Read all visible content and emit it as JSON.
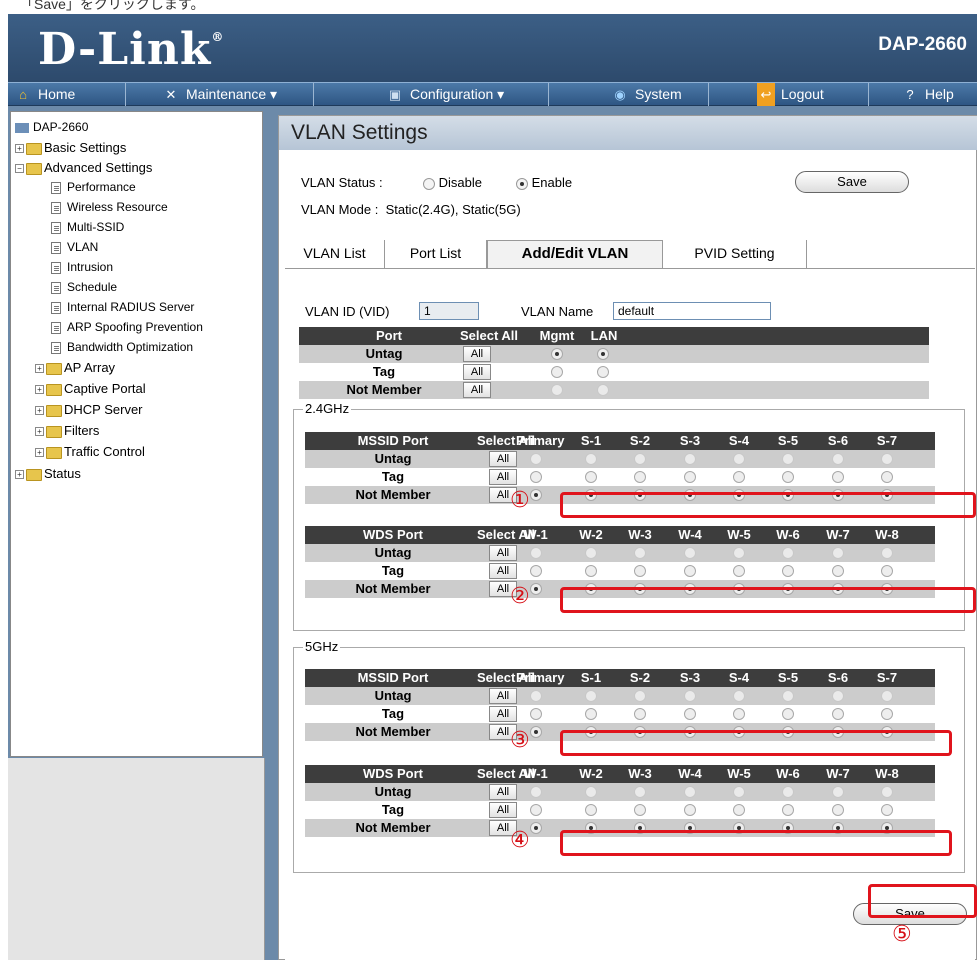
{
  "caption": "「Save」をクリックします。",
  "brand": {
    "logo": "D-Link",
    "model": "DAP-2660"
  },
  "nav": [
    {
      "label": "Home",
      "icon": "home-icon"
    },
    {
      "label": "Maintenance ▾",
      "icon": "tools-icon"
    },
    {
      "label": "Configuration ▾",
      "icon": "disk-icon"
    },
    {
      "label": "System",
      "icon": "globe-icon"
    },
    {
      "label": "Logout",
      "icon": "logout-icon"
    },
    {
      "label": "Help",
      "icon": "help-icon"
    }
  ],
  "tree": {
    "root": "DAP-2660",
    "basic": "Basic Settings",
    "advanced": "Advanced Settings",
    "children": [
      "Performance",
      "Wireless Resource",
      "Multi-SSID",
      "VLAN",
      "Intrusion",
      "Schedule",
      "Internal RADIUS Server",
      "ARP Spoofing Prevention",
      "Bandwidth Optimization"
    ],
    "folders": [
      "AP Array",
      "Captive Portal",
      "DHCP Server",
      "Filters",
      "Traffic Control"
    ],
    "status": "Status"
  },
  "page": {
    "title": "VLAN Settings",
    "vlan_status_label": "VLAN Status :",
    "disable": "Disable",
    "enable": "Enable",
    "vlan_mode_label": "VLAN Mode :",
    "vlan_mode_value": "Static(2.4G),  Static(5G)",
    "save": "Save",
    "tabs": [
      "VLAN List",
      "Port List",
      "Add/Edit VLAN",
      "PVID Setting"
    ],
    "vid_label": "VLAN ID (VID)",
    "vid_value": "1",
    "name_label": "VLAN Name",
    "name_value": "default",
    "all": "All",
    "mgmt_headers": [
      "Port",
      "Select All",
      "Mgmt",
      "LAN"
    ],
    "row_labels": [
      "Untag",
      "Tag",
      "Not Member"
    ],
    "band24": "2.4GHz",
    "band5": "5GHz",
    "mssid_headers": [
      "MSSID Port",
      "Select All",
      "Primary",
      "S-1",
      "S-2",
      "S-3",
      "S-4",
      "S-5",
      "S-6",
      "S-7"
    ],
    "wds_headers": [
      "WDS Port",
      "Select All",
      "W-1",
      "W-2",
      "W-3",
      "W-4",
      "W-5",
      "W-6",
      "W-7",
      "W-8"
    ],
    "markers": [
      "①",
      "②",
      "③",
      "④",
      "⑤"
    ]
  }
}
